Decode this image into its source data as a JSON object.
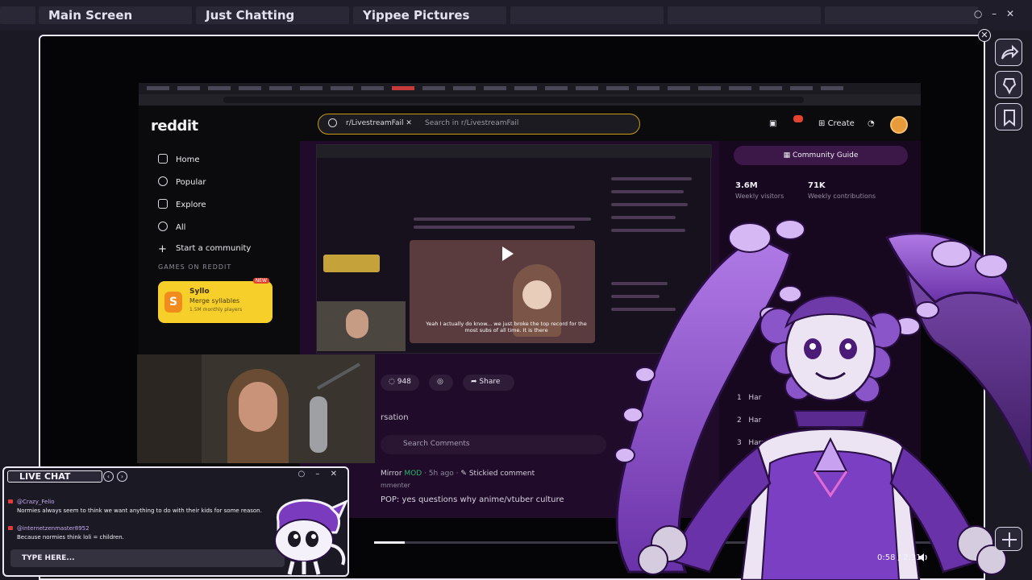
{
  "top_tabs": [
    {
      "label": "Main Screen"
    },
    {
      "label": "Just Chatting"
    },
    {
      "label": "Yippee Pictures"
    },
    {
      "label": ""
    },
    {
      "label": ""
    },
    {
      "label": ""
    }
  ],
  "window_controls": "○ – ✕",
  "frame_close": "✕",
  "reddit": {
    "logo": "reddit",
    "search_chip": "r/LivestreamFail ✕",
    "search_placeholder": "Search in r/LivestreamFail",
    "badge": "99+",
    "create_label": "Create",
    "nav": [
      {
        "label": "Home"
      },
      {
        "label": "Popular"
      },
      {
        "label": "Explore"
      },
      {
        "label": "All"
      },
      {
        "label": "Start a community"
      }
    ],
    "games_title": "GAMES ON REDDIT",
    "game": {
      "icon": "S",
      "name": "Syllo",
      "desc": "Merge syllables",
      "players": "1.5M monthly players",
      "new_badge": "NEW"
    },
    "inner_caption": "Yeah I actually do know... we just broke the top record for the most subs of all time. It is there",
    "actions": {
      "comments": "948",
      "share": "Share"
    },
    "conversation": "rsation",
    "search_comments": "Search Comments",
    "comment": {
      "author": "Mirror",
      "mod": "MOD",
      "time": "· 5h ago ·",
      "stickied": "Stickied comment",
      "sub": "mmenter",
      "text": "POP: yes questions why anime/vtuber culture"
    },
    "community_guide": "Community Guide",
    "stats": [
      {
        "value": "3.6M",
        "label": "Weekly visitors"
      },
      {
        "value": "71K",
        "label": "Weekly contributions"
      }
    ],
    "ranks": [
      {
        "num": "1",
        "name": "Har"
      },
      {
        "num": "2",
        "name": "Har"
      },
      {
        "num": "3",
        "name": "Harar"
      }
    ]
  },
  "player": {
    "time": "0:58 / 2:31",
    "progress": 0.054
  },
  "chat": {
    "title": "LIVE CHAT",
    "prev": "‹",
    "next": "›",
    "controls": "○ – ✕",
    "messages": [
      {
        "user": "@Crazy_Felio",
        "text": "Normies always seem to think we want anything to do with their kids for some reason."
      },
      {
        "user": "@internetzenmaster8952",
        "text": "Because normies think loli = children."
      }
    ],
    "input_placeholder": "TYPE HERE..."
  },
  "colors": {
    "accent_purple": "#7a3bbf",
    "reddit_search_border": "#c79b13",
    "syllo_yellow": "#f6cf2a"
  },
  "icons": [
    "share-arrow-icon",
    "pin-icon",
    "bookmark-icon",
    "volume-icon",
    "search-icon",
    "home-icon",
    "popular-icon",
    "explore-icon",
    "all-icon",
    "plus-icon",
    "bell-icon"
  ]
}
